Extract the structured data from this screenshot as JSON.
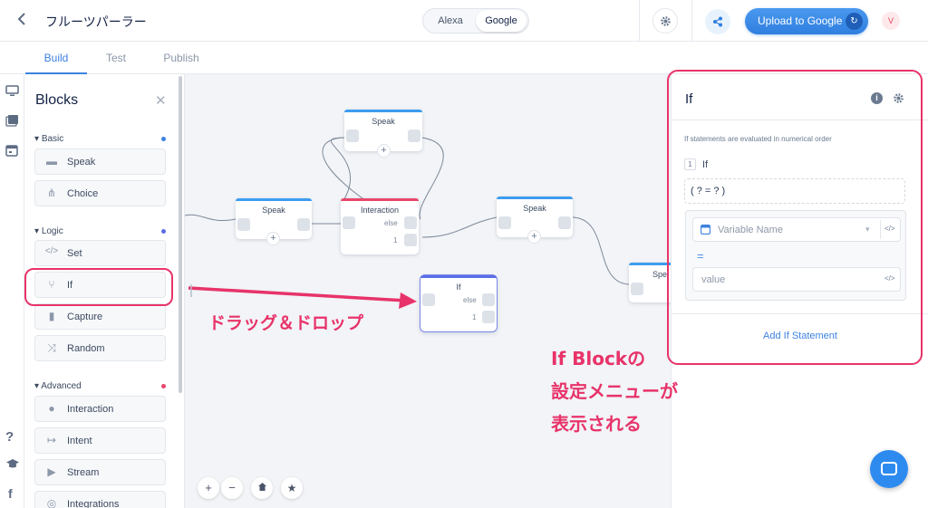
{
  "header": {
    "back": "<",
    "project_title": "フルーツパーラー",
    "platforms": [
      "Alexa",
      "Google"
    ],
    "upload_label": "Upload to Google",
    "avatar": "V"
  },
  "tabs": [
    "Build",
    "Test",
    "Publish"
  ],
  "blocks_panel": {
    "title": "Blocks",
    "sections": [
      {
        "label": "Basic",
        "items": [
          "Speak",
          "Choice"
        ]
      },
      {
        "label": "Logic",
        "items": [
          "Set",
          "If",
          "Capture",
          "Random"
        ]
      },
      {
        "label": "Advanced",
        "items": [
          "Interaction",
          "Intent",
          "Stream",
          "Integrations"
        ]
      }
    ]
  },
  "canvas": {
    "speak_label": "Speak",
    "interaction_label": "Interaction",
    "if_label": "If",
    "else_label": "else",
    "one_label": "1",
    "partial_speak": "Spe"
  },
  "right_panel": {
    "title": "If",
    "description": "If statements are evaluated in numerical order",
    "statement_number": "1",
    "statement_label": "If",
    "expression": "( ? = ? )",
    "variable_placeholder": "Variable Name",
    "equals": "=",
    "value_placeholder": "value",
    "add_label": "Add If Statement"
  },
  "annotations": {
    "drag_drop": "ドラッグ＆ドロップ",
    "menu_line1": "If Blockの",
    "menu_line2": "設定メニューが",
    "menu_line3": "表示される"
  },
  "colors": {
    "accent": "#3d82e0",
    "highlight": "#e8336a",
    "basic_dot": "#3d82e0",
    "logic_dot": "#5b6ee8",
    "advanced_dot": "#e8476a"
  }
}
